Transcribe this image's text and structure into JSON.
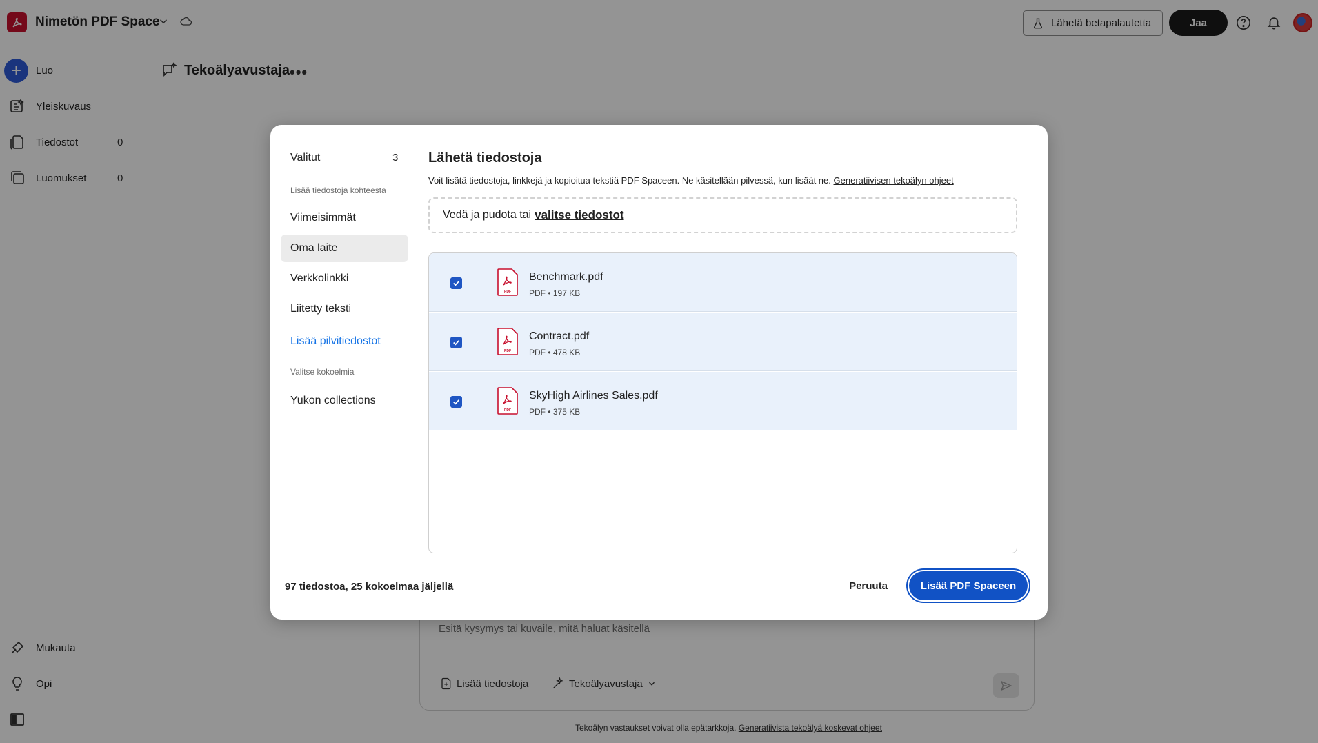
{
  "app": {
    "title": "Nimetön PDF Space",
    "beta_feedback_label": "Lähetä betapalautetta",
    "share_label": "Jaa"
  },
  "sidebar": {
    "items": [
      {
        "label": "Luo",
        "icon": "plus-icon"
      },
      {
        "label": "Yleiskuvaus",
        "icon": "overview-icon"
      },
      {
        "label": "Tiedostot",
        "icon": "files-icon",
        "count": "0"
      },
      {
        "label": "Luomukset",
        "icon": "creations-icon",
        "count": "0"
      }
    ],
    "bottom_items": [
      {
        "label": "Mukauta",
        "icon": "customize-icon"
      },
      {
        "label": "Opi",
        "icon": "lightbulb-icon"
      }
    ]
  },
  "main": {
    "assistant_title": "Tekoälyavustaja",
    "composer": {
      "placeholder": "Esitä kysymys tai kuvaile, mitä haluat käsitellä",
      "add_files_label": "Lisää tiedostoja",
      "assistant_label": "Tekoälyavustaja"
    },
    "disclaimer_text": "Tekoälyn vastaukset voivat olla epätarkkoja.",
    "disclaimer_link": "Generatiivista tekoälyä koskevat ohjeet"
  },
  "modal": {
    "nav": {
      "selected_label": "Valitut",
      "selected_count": "3",
      "section_add_from": "Lisää tiedostoja kohteesta",
      "items": [
        "Viimeisimmät",
        "Oma laite",
        "Verkkolinkki",
        "Liitetty teksti"
      ],
      "cloud_link": "Lisää pilvitiedostot",
      "section_collections": "Valitse kokoelmia",
      "collection_item": "Yukon collections"
    },
    "title": "Lähetä tiedostoja",
    "description": "Voit lisätä tiedostoja, linkkejä ja kopioitua tekstiä PDF Spaceen. Ne käsitellään pilvessä, kun lisäät ne.",
    "description_link": "Generatiivisen tekoälyn ohjeet",
    "dropzone_text": "Vedä ja pudota tai",
    "dropzone_link": "valitse tiedostot",
    "files": [
      {
        "name": "Benchmark.pdf",
        "meta": "PDF • 197 KB",
        "checked": true
      },
      {
        "name": "Contract.pdf",
        "meta": "PDF • 478 KB",
        "checked": true
      },
      {
        "name": "SkyHigh Airlines Sales.pdf",
        "meta": "PDF • 375 KB",
        "checked": true
      }
    ],
    "remaining_text": "97 tiedostoa, 25 kokoelmaa jäljellä",
    "cancel_label": "Peruuta",
    "add_label": "Lisää PDF Spaceen"
  },
  "colors": {
    "primary_blue": "#1152c5",
    "link_blue": "#1473e6",
    "brand_red": "#c8102e",
    "selected_row_bg": "#e9f1fb"
  }
}
